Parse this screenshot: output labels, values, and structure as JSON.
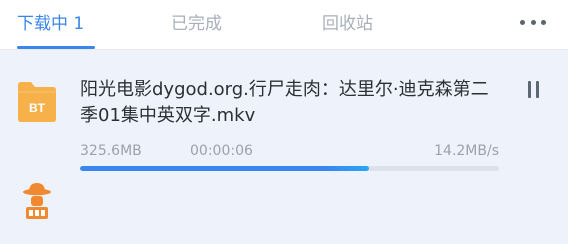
{
  "tabs": [
    {
      "label": "下载中 1",
      "active": true
    },
    {
      "label": "已完成",
      "active": false
    },
    {
      "label": "回收站",
      "active": false
    }
  ],
  "more_icon": "more-horizontal-icon",
  "download": {
    "file_name": "阳光电影dygod.org.行尸走肉：达里尔·迪克森第二季01集中英双字.mkv",
    "file_icon": "bt-folder-icon",
    "file_icon_label": "BT",
    "size": "325.6MB",
    "elapsed": "00:00:06",
    "speed": "14.2MB/s",
    "progress": 0.69,
    "control_icon": "pause-icon"
  },
  "mascot_icon": "mascot-icon",
  "colors": {
    "accent": "#3b86ea",
    "folder": "#f6b14a",
    "mascot": "#f0892f"
  }
}
